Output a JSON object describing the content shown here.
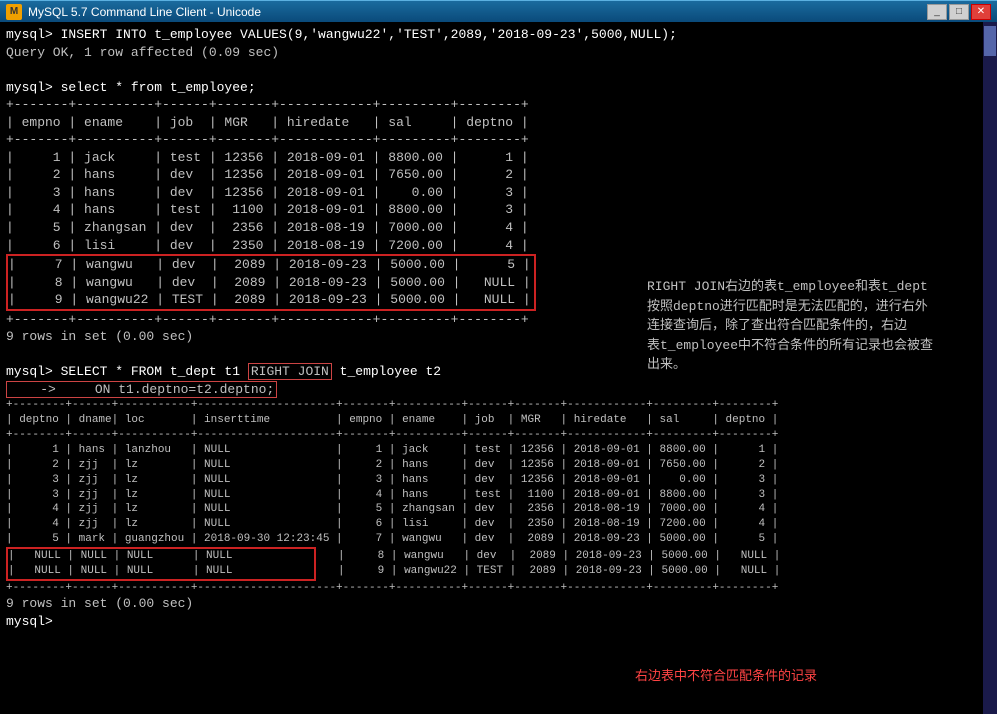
{
  "titleBar": {
    "icon": "M",
    "title": "MySQL 5.7 Command Line Client - Unicode",
    "controls": [
      "_",
      "□",
      "✕"
    ]
  },
  "terminal": {
    "insertCmd": "mysql> INSERT INTO t_employee VALUES(9,'wangwu22','TEST',2089,'2018-09-23',5000,NULL);",
    "queryOk": "Query OK, 1 row affected (0.09 sec)",
    "selectCmd": "mysql> select * from t_employee;",
    "table1": {
      "headers": [
        "empno",
        "ename",
        "job",
        "MGR",
        "hiredate",
        "sal",
        "deptno"
      ],
      "separator": "+-------+----------+------+-------+------------+---------+--------+",
      "rows": [
        [
          "1",
          "jack",
          "test",
          "12356",
          "2018-09-01",
          "8800.00",
          "1"
        ],
        [
          "2",
          "hans",
          "dev",
          "12356",
          "2018-09-01",
          "7650.00",
          "2"
        ],
        [
          "3",
          "hans",
          "dev",
          "12356",
          "2018-09-01",
          "0.00",
          "3"
        ],
        [
          "4",
          "hans",
          "test",
          "1100",
          "2018-09-01",
          "8800.00",
          "3"
        ],
        [
          "5",
          "zhangsan",
          "dev",
          "2356",
          "2018-08-19",
          "7000.00",
          "4"
        ],
        [
          "6",
          "lisi",
          "dev",
          "2350",
          "2018-08-19",
          "7200.00",
          "4"
        ],
        [
          "7",
          "wangwu",
          "dev",
          "2089",
          "2018-09-23",
          "5000.00",
          "5"
        ],
        [
          "8",
          "wangwu",
          "dev",
          "2089",
          "2018-09-23",
          "5000.00",
          "NULL"
        ],
        [
          "9",
          "wangwu22",
          "TEST",
          "2089",
          "2018-09-23",
          "5000.00",
          "NULL"
        ]
      ]
    },
    "rowsMsg1": "9 rows in set (0.00 sec)",
    "selectCmd2a": "mysql> SELECT * FROM t_dept t1 ",
    "rightJoin": "RIGHT JOIN",
    "selectCmd2b": " t_employee t2",
    "selectCmd2c": "    ->     ON t1.deptno=t2.deptno;",
    "table2": {
      "headers": [
        "deptno",
        "dname",
        "loc",
        "inserttime",
        "empno",
        "ename",
        "job",
        "MGR",
        "hiredate",
        "sal",
        "deptno"
      ],
      "separator": "+--------+------+---------+---------------------+-------+----------+------+-------+------------+---------+--------+",
      "rows": [
        [
          "1",
          "hans",
          "lanzhou",
          "NULL",
          "1",
          "jack",
          "test",
          "12356",
          "2018-09-01",
          "8800.00",
          "1"
        ],
        [
          "2",
          "zjj",
          "lz",
          "NULL",
          "2",
          "hans",
          "dev",
          "12356",
          "2018-09-01",
          "7650.00",
          "2"
        ],
        [
          "3",
          "zjj",
          "lz",
          "NULL",
          "3",
          "hans",
          "dev",
          "12356",
          "2018-09-01",
          "0.00",
          "3"
        ],
        [
          "3",
          "zjj",
          "lz",
          "NULL",
          "4",
          "hans",
          "test",
          "1100",
          "2018-09-01",
          "8800.00",
          "3"
        ],
        [
          "4",
          "zjj",
          "lz",
          "NULL",
          "5",
          "zhangsan",
          "dev",
          "2356",
          "2018-08-19",
          "7000.00",
          "4"
        ],
        [
          "4",
          "zjj",
          "lz",
          "NULL",
          "6",
          "lisi",
          "dev",
          "2350",
          "2018-08-19",
          "7200.00",
          "4"
        ],
        [
          "5",
          "mark",
          "guangzhou",
          "2018-09-30 12:23:45",
          "7",
          "wangwu",
          "dev",
          "2089",
          "2018-09-23",
          "5000.00",
          "5"
        ],
        [
          "NULL",
          "NULL",
          "NULL",
          "NULL",
          "8",
          "wangwu",
          "dev",
          "2089",
          "2018-09-23",
          "5000.00",
          "NULL"
        ],
        [
          "NULL",
          "NULL",
          "NULL",
          "NULL",
          "9",
          "wangwu22",
          "TEST",
          "2089",
          "2018-09-23",
          "5000.00",
          "NULL"
        ]
      ]
    },
    "rowsMsg2": "9 rows in set (0.00 sec)",
    "annotation": {
      "line1": "RIGHT JOIN右边的表t_employee和表t_dept",
      "line2": "按照deptno进行匹配时是无法匹配的，进行右外",
      "line3": "连接查询后，除了查出符合匹配条件的，右边",
      "line4": "表t_employee中不符合条件的所有记录也会被查",
      "line5": "出来。"
    },
    "bottomAnnotation": "右边表中不符合匹配条件的记录",
    "finalPrompt": "mysql> "
  }
}
